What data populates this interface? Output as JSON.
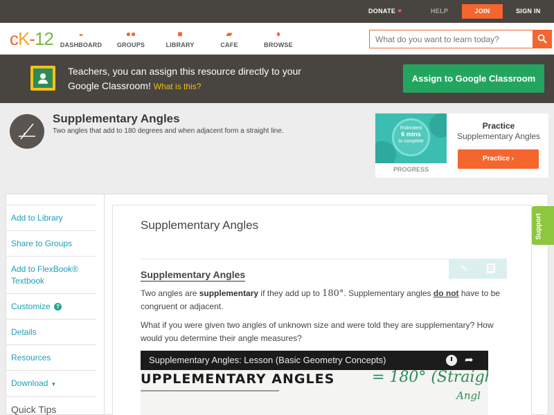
{
  "topbar": {
    "donate": "DONATE",
    "help": "HELP",
    "join": "JOIN",
    "signin": "SIGN IN"
  },
  "nav": {
    "logo": {
      "c": "c",
      "k": "K",
      "dash": "-",
      "num": "12"
    },
    "items": [
      {
        "label": "DASHBOARD",
        "icon": "dashboard-icon"
      },
      {
        "label": "GROUPS",
        "icon": "groups-icon"
      },
      {
        "label": "LIBRARY",
        "icon": "library-icon"
      },
      {
        "label": "CAFE",
        "icon": "cafe-icon"
      },
      {
        "label": "BROWSE",
        "icon": "browse-icon"
      }
    ],
    "search_placeholder": "What do you want to learn today?"
  },
  "banner": {
    "text": "Teachers, you can assign this resource directly to your Google Classroom!",
    "link": "What is this?",
    "button": "Assign to Google Classroom"
  },
  "concept": {
    "title": "Supplementary Angles",
    "description": "Two angles that add to 180 degrees and when adjacent form a straight line."
  },
  "practice": {
    "estimate_line1": "Estimated",
    "estimate_line2": "6 mins",
    "estimate_line3": "to complete",
    "progress_label": "PROGRESS",
    "heading": "Practice",
    "subtitle": "Supplementary Angles",
    "button": "Practice"
  },
  "sidebar": {
    "items": [
      "Add to Library",
      "Share to Groups",
      "Add to FlexBook® Textbook",
      "Customize",
      "Details",
      "Resources",
      "Download"
    ],
    "quick_tips": "Quick Tips"
  },
  "main": {
    "title": "Supplementary Angles",
    "section_title": "Supplementary Angles",
    "p1_a": "Two angles are ",
    "p1_b": "supplementary",
    "p1_c": " if they add up to ",
    "p1_math": "180°",
    "p1_d": ". Supplementary angles ",
    "p1_e": "do not",
    "p1_f": " have to be congruent or adjacent.",
    "p2": "What if you were given two angles of unknown size and were told they are supplementary? How would you determine their angle measures?"
  },
  "video": {
    "title": "Supplementary Angles: Lesson (Basic Geometry Concepts)",
    "board_text": "UPPLEMENTARY ANGLES",
    "board_hand": "= 180° (Straigh",
    "board_hand2": "Angl"
  },
  "support": "Support",
  "colors": {
    "accent_orange": "#f5652e",
    "google_green": "#23a560",
    "link_teal": "#1a9fb5",
    "support_green": "#8dc63f",
    "dark_bar": "#48443f"
  }
}
